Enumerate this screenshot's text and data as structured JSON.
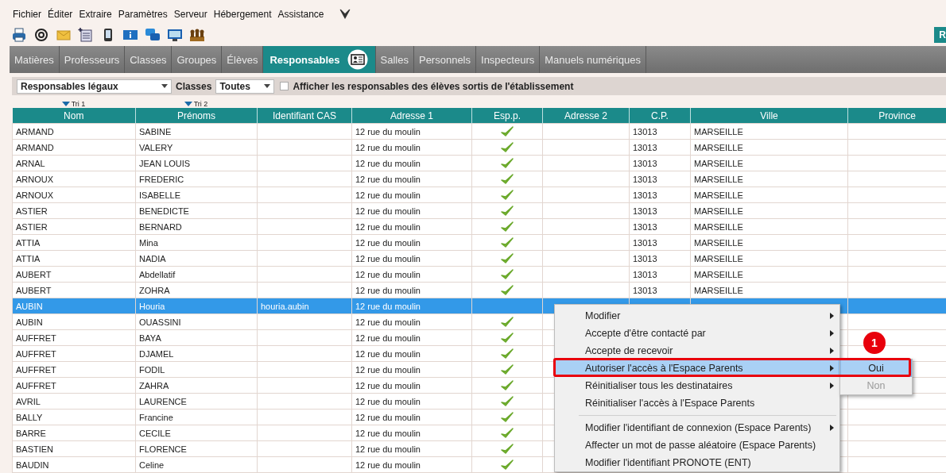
{
  "menu_bar": [
    "Fichier",
    "Éditer",
    "Extraire",
    "Paramètres",
    "Serveur",
    "Hébergement",
    "Assistance"
  ],
  "top_right_button": "R",
  "tabs": [
    {
      "label": "Matières",
      "selected": false
    },
    {
      "label": "Professeurs",
      "selected": false
    },
    {
      "label": "Classes",
      "selected": false
    },
    {
      "label": "Groupes",
      "selected": false
    },
    {
      "label": "Élèves",
      "selected": false
    },
    {
      "label": "Responsables",
      "selected": true
    },
    {
      "label": "Salles",
      "selected": false
    },
    {
      "label": "Personnels",
      "selected": false
    },
    {
      "label": "Inspecteurs",
      "selected": false
    },
    {
      "label": "Manuels numériques",
      "selected": false
    }
  ],
  "filters": {
    "group_select": "Responsables légaux",
    "classes_label": "Classes",
    "classes_select": "Toutes",
    "show_former": {
      "label": "Afficher les responsables des élèves sortis de l'établissement",
      "checked": false
    }
  },
  "table": {
    "columns": [
      {
        "label": "Nom",
        "sort": "Tri 1"
      },
      {
        "label": "Prénoms",
        "sort": "Tri 2"
      },
      {
        "label": "Identifiant CAS"
      },
      {
        "label": "Adresse 1"
      },
      {
        "label": "Esp.p."
      },
      {
        "label": "Adresse 2"
      },
      {
        "label": "C.P."
      },
      {
        "label": "Ville"
      },
      {
        "label": "Province"
      }
    ],
    "rows": [
      {
        "nom": "ARMAND",
        "prenom": "SABINE",
        "adresse_1": "12 rue du moulin",
        "esp_p": true,
        "cp": "13013",
        "ville": "MARSEILLE",
        "selected": false
      },
      {
        "nom": "ARMAND",
        "prenom": "VALERY",
        "adresse_1": "12 rue du moulin",
        "esp_p": true,
        "cp": "13013",
        "ville": "MARSEILLE",
        "selected": false
      },
      {
        "nom": "ARNAL",
        "prenom": "JEAN LOUIS",
        "adresse_1": "12 rue du moulin",
        "esp_p": true,
        "cp": "13013",
        "ville": "MARSEILLE",
        "selected": false
      },
      {
        "nom": "ARNOUX",
        "prenom": "FREDERIC",
        "adresse_1": "12 rue du moulin",
        "esp_p": true,
        "cp": "13013",
        "ville": "MARSEILLE",
        "selected": false
      },
      {
        "nom": "ARNOUX",
        "prenom": "ISABELLE",
        "adresse_1": "12 rue du moulin",
        "esp_p": true,
        "cp": "13013",
        "ville": "MARSEILLE",
        "selected": false
      },
      {
        "nom": "ASTIER",
        "prenom": "BENEDICTE",
        "adresse_1": "12 rue du moulin",
        "esp_p": true,
        "cp": "13013",
        "ville": "MARSEILLE",
        "selected": false
      },
      {
        "nom": "ASTIER",
        "prenom": "BERNARD",
        "adresse_1": "12 rue du moulin",
        "esp_p": true,
        "cp": "13013",
        "ville": "MARSEILLE",
        "selected": false
      },
      {
        "nom": "ATTIA",
        "prenom": "Mina",
        "adresse_1": "12 rue du moulin",
        "esp_p": true,
        "cp": "13013",
        "ville": "MARSEILLE",
        "selected": false
      },
      {
        "nom": "ATTIA",
        "prenom": "NADIA",
        "adresse_1": "12 rue du moulin",
        "esp_p": true,
        "cp": "13013",
        "ville": "MARSEILLE",
        "selected": false
      },
      {
        "nom": "AUBERT",
        "prenom": "Abdellatif",
        "adresse_1": "12 rue du moulin",
        "esp_p": true,
        "cp": "13013",
        "ville": "MARSEILLE",
        "selected": false
      },
      {
        "nom": "AUBERT",
        "prenom": "ZOHRA",
        "adresse_1": "12 rue du moulin",
        "esp_p": true,
        "cp": "13013",
        "ville": "MARSEILLE",
        "selected": false
      },
      {
        "nom": "AUBIN",
        "prenom": "Houria",
        "identifiant_cas": "houria.aubin",
        "adresse_1": "12 rue du moulin",
        "esp_p": false,
        "selected": true
      },
      {
        "nom": "AUBIN",
        "prenom": "OUASSINI",
        "adresse_1": "12 rue du moulin",
        "esp_p": true,
        "selected": false
      },
      {
        "nom": "AUFFRET",
        "prenom": "BAYA",
        "adresse_1": "12 rue du moulin",
        "esp_p": true,
        "selected": false
      },
      {
        "nom": "AUFFRET",
        "prenom": "DJAMEL",
        "adresse_1": "12 rue du moulin",
        "esp_p": true,
        "selected": false
      },
      {
        "nom": "AUFFRET",
        "prenom": "FODIL",
        "adresse_1": "12 rue du moulin",
        "esp_p": true,
        "selected": false
      },
      {
        "nom": "AUFFRET",
        "prenom": "ZAHRA",
        "adresse_1": "12 rue du moulin",
        "esp_p": true,
        "selected": false
      },
      {
        "nom": "AVRIL",
        "prenom": "LAURENCE",
        "adresse_1": "12 rue du moulin",
        "esp_p": true,
        "selected": false
      },
      {
        "nom": "BALLY",
        "prenom": "Francine",
        "adresse_1": "12 rue du moulin",
        "esp_p": true,
        "selected": false
      },
      {
        "nom": "BARRE",
        "prenom": "CECILE",
        "adresse_1": "12 rue du moulin",
        "esp_p": true,
        "selected": false
      },
      {
        "nom": "BASTIEN",
        "prenom": "FLORENCE",
        "adresse_1": "12 rue du moulin",
        "esp_p": true,
        "selected": false
      },
      {
        "nom": "BAUDIN",
        "prenom": "Celine",
        "adresse_1": "12 rue du moulin",
        "esp_p": true,
        "selected": false
      }
    ]
  },
  "context_menu": {
    "items": [
      {
        "kind": "item",
        "label": "Modifier",
        "submenu": true,
        "selected": false
      },
      {
        "kind": "item",
        "label": "Accepte d'être contacté par",
        "submenu": true,
        "selected": false
      },
      {
        "kind": "item",
        "label": "Accepte de recevoir",
        "submenu": true,
        "selected": false
      },
      {
        "kind": "item",
        "label": "Autoriser l'accès à l'Espace Parents",
        "submenu": true,
        "selected": true
      },
      {
        "kind": "item",
        "label": "Réinitialiser tous les destinataires",
        "submenu": true,
        "selected": false
      },
      {
        "kind": "item",
        "label": "Réinitialiser l'accès à l'Espace Parents",
        "submenu": false,
        "selected": false
      },
      {
        "kind": "separator"
      },
      {
        "kind": "item",
        "label": "Modifier l'identifiant de connexion (Espace Parents)",
        "submenu": true,
        "selected": false
      },
      {
        "kind": "item",
        "label": "Affecter un mot de passe aléatoire (Espace Parents)",
        "submenu": false,
        "selected": false
      },
      {
        "kind": "item",
        "label": "Modifier l'identifiant PRONOTE (ENT)",
        "submenu": false,
        "selected": false
      }
    ],
    "submenu": [
      {
        "label": "Oui",
        "selected": true,
        "disabled": false
      },
      {
        "label": "Non",
        "selected": false,
        "disabled": true
      }
    ]
  },
  "callout": {
    "badge": "1"
  }
}
